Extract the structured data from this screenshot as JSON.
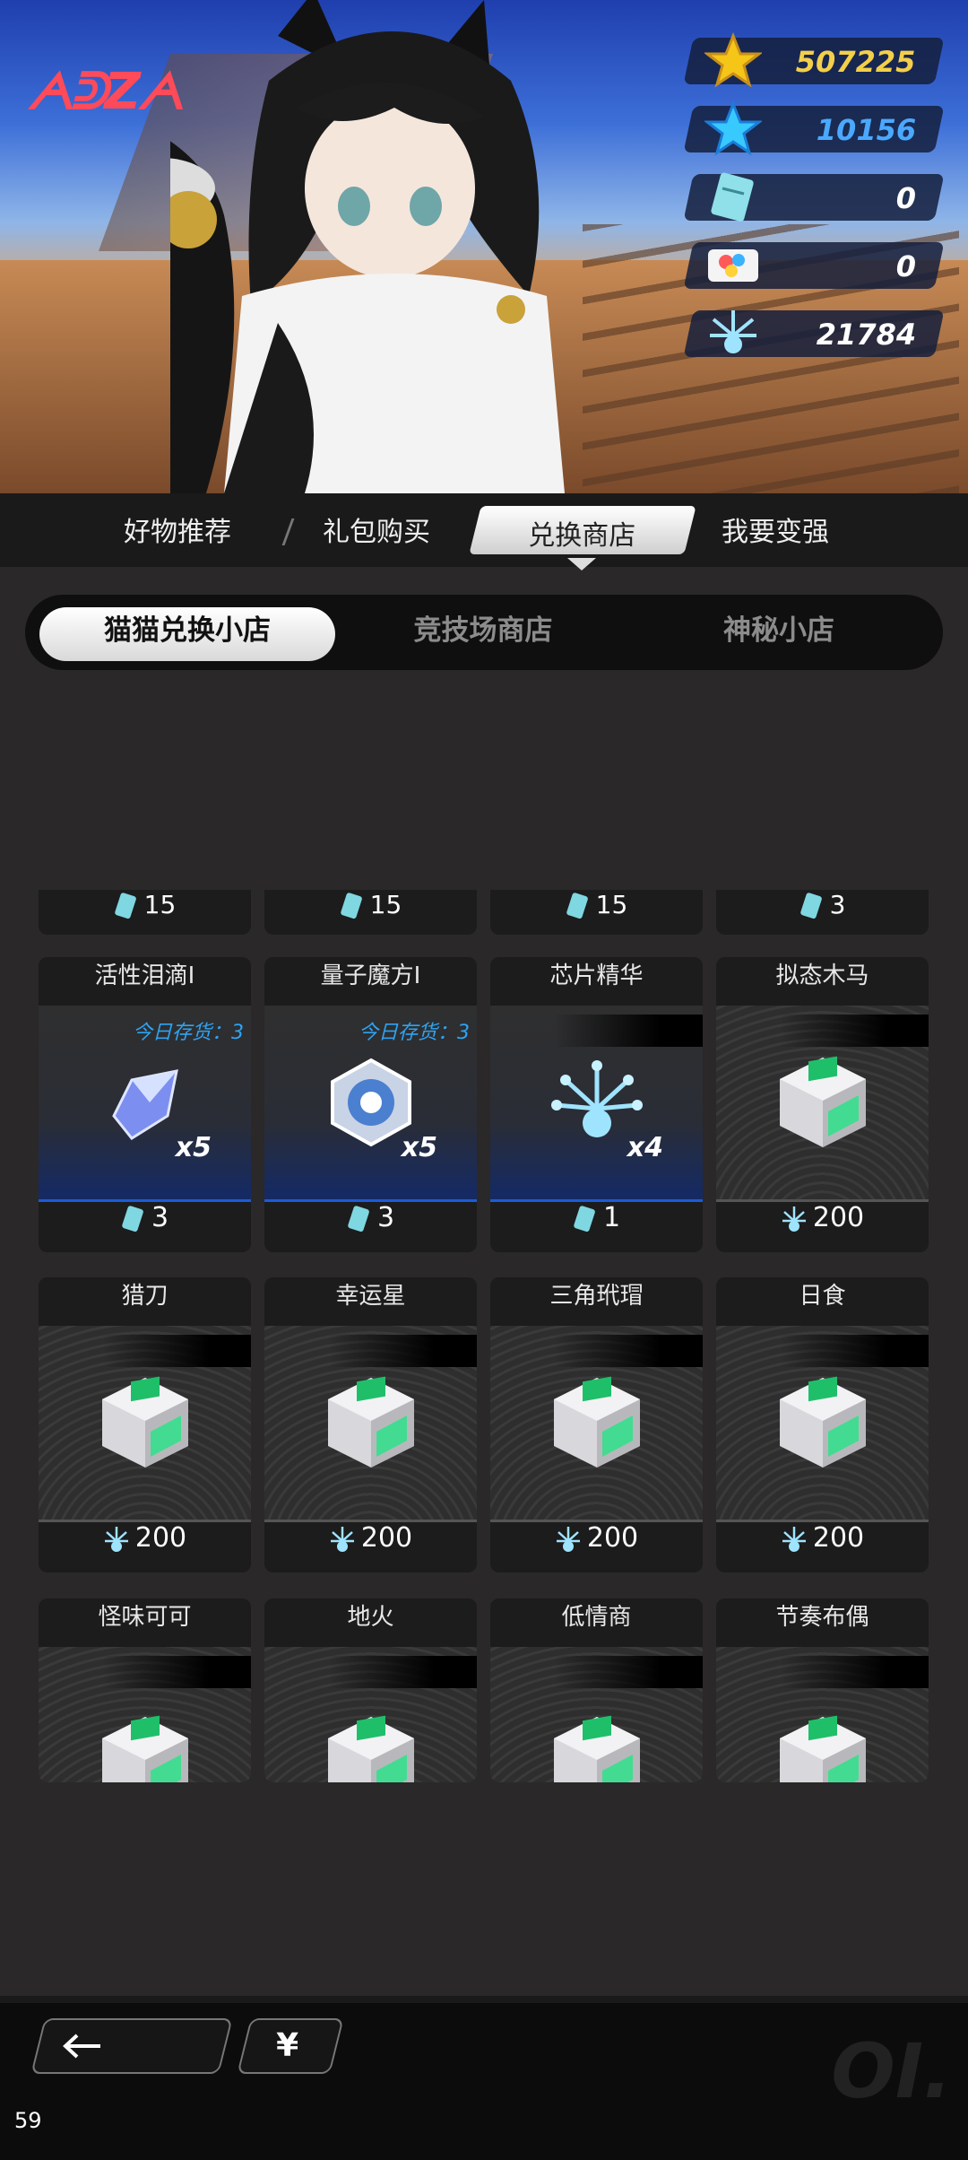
{
  "currencies": [
    {
      "name": "gold-star-coin",
      "value": "507225"
    },
    {
      "name": "blue-star-gem",
      "value": "10156"
    },
    {
      "name": "exchange-ticket",
      "value": "0"
    },
    {
      "name": "sticker-book",
      "value": "0"
    },
    {
      "name": "chip-essence",
      "value": "21784"
    }
  ],
  "tabs": {
    "t1": "好物推荐",
    "t2": "礼包购买",
    "t3": "兑换商店",
    "t4": "我要变强"
  },
  "subtabs": {
    "s1": "猫猫兑换小店",
    "s2": "竞技场商店",
    "s3": "神秘小店"
  },
  "strip_prices": [
    "15",
    "15",
    "15",
    "3"
  ],
  "items": [
    {
      "name": "活性泪滴I",
      "stock": "今日存货：3",
      "qty": "x5",
      "price": "3",
      "currency": "ticket"
    },
    {
      "name": "量子魔方I",
      "stock": "今日存货：3",
      "qty": "x5",
      "price": "3",
      "currency": "ticket"
    },
    {
      "name": "芯片精华",
      "qty": "x4",
      "price": "1",
      "currency": "ticket"
    },
    {
      "name": "拟态木马",
      "price": "200",
      "currency": "essence"
    },
    {
      "name": "猎刀",
      "price": "200",
      "currency": "essence"
    },
    {
      "name": "幸运星",
      "price": "200",
      "currency": "essence"
    },
    {
      "name": "三角玳瑁",
      "price": "200",
      "currency": "essence"
    },
    {
      "name": "日食",
      "price": "200",
      "currency": "essence"
    },
    {
      "name": "怪味可可"
    },
    {
      "name": "地火"
    },
    {
      "name": "低情商"
    },
    {
      "name": "节奏布偶"
    }
  ],
  "logo": "ᗅᕲZᗅ",
  "bottom": {
    "yen": "¥"
  },
  "fps": "59",
  "watermark": "OI."
}
